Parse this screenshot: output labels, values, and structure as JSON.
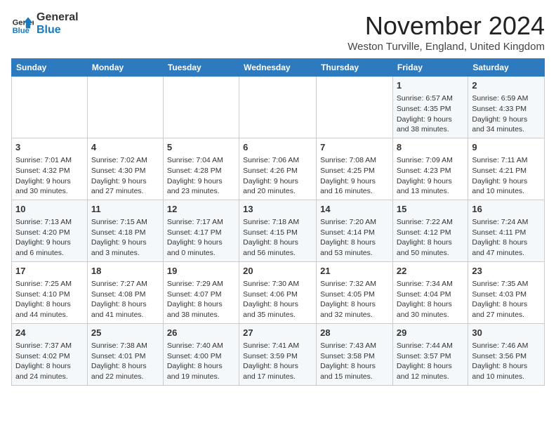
{
  "logo": {
    "line1": "General",
    "line2": "Blue"
  },
  "title": "November 2024",
  "location": "Weston Turville, England, United Kingdom",
  "days_of_week": [
    "Sunday",
    "Monday",
    "Tuesday",
    "Wednesday",
    "Thursday",
    "Friday",
    "Saturday"
  ],
  "weeks": [
    [
      {
        "day": "",
        "info": ""
      },
      {
        "day": "",
        "info": ""
      },
      {
        "day": "",
        "info": ""
      },
      {
        "day": "",
        "info": ""
      },
      {
        "day": "",
        "info": ""
      },
      {
        "day": "1",
        "info": "Sunrise: 6:57 AM\nSunset: 4:35 PM\nDaylight: 9 hours and 38 minutes."
      },
      {
        "day": "2",
        "info": "Sunrise: 6:59 AM\nSunset: 4:33 PM\nDaylight: 9 hours and 34 minutes."
      }
    ],
    [
      {
        "day": "3",
        "info": "Sunrise: 7:01 AM\nSunset: 4:32 PM\nDaylight: 9 hours and 30 minutes."
      },
      {
        "day": "4",
        "info": "Sunrise: 7:02 AM\nSunset: 4:30 PM\nDaylight: 9 hours and 27 minutes."
      },
      {
        "day": "5",
        "info": "Sunrise: 7:04 AM\nSunset: 4:28 PM\nDaylight: 9 hours and 23 minutes."
      },
      {
        "day": "6",
        "info": "Sunrise: 7:06 AM\nSunset: 4:26 PM\nDaylight: 9 hours and 20 minutes."
      },
      {
        "day": "7",
        "info": "Sunrise: 7:08 AM\nSunset: 4:25 PM\nDaylight: 9 hours and 16 minutes."
      },
      {
        "day": "8",
        "info": "Sunrise: 7:09 AM\nSunset: 4:23 PM\nDaylight: 9 hours and 13 minutes."
      },
      {
        "day": "9",
        "info": "Sunrise: 7:11 AM\nSunset: 4:21 PM\nDaylight: 9 hours and 10 minutes."
      }
    ],
    [
      {
        "day": "10",
        "info": "Sunrise: 7:13 AM\nSunset: 4:20 PM\nDaylight: 9 hours and 6 minutes."
      },
      {
        "day": "11",
        "info": "Sunrise: 7:15 AM\nSunset: 4:18 PM\nDaylight: 9 hours and 3 minutes."
      },
      {
        "day": "12",
        "info": "Sunrise: 7:17 AM\nSunset: 4:17 PM\nDaylight: 9 hours and 0 minutes."
      },
      {
        "day": "13",
        "info": "Sunrise: 7:18 AM\nSunset: 4:15 PM\nDaylight: 8 hours and 56 minutes."
      },
      {
        "day": "14",
        "info": "Sunrise: 7:20 AM\nSunset: 4:14 PM\nDaylight: 8 hours and 53 minutes."
      },
      {
        "day": "15",
        "info": "Sunrise: 7:22 AM\nSunset: 4:12 PM\nDaylight: 8 hours and 50 minutes."
      },
      {
        "day": "16",
        "info": "Sunrise: 7:24 AM\nSunset: 4:11 PM\nDaylight: 8 hours and 47 minutes."
      }
    ],
    [
      {
        "day": "17",
        "info": "Sunrise: 7:25 AM\nSunset: 4:10 PM\nDaylight: 8 hours and 44 minutes."
      },
      {
        "day": "18",
        "info": "Sunrise: 7:27 AM\nSunset: 4:08 PM\nDaylight: 8 hours and 41 minutes."
      },
      {
        "day": "19",
        "info": "Sunrise: 7:29 AM\nSunset: 4:07 PM\nDaylight: 8 hours and 38 minutes."
      },
      {
        "day": "20",
        "info": "Sunrise: 7:30 AM\nSunset: 4:06 PM\nDaylight: 8 hours and 35 minutes."
      },
      {
        "day": "21",
        "info": "Sunrise: 7:32 AM\nSunset: 4:05 PM\nDaylight: 8 hours and 32 minutes."
      },
      {
        "day": "22",
        "info": "Sunrise: 7:34 AM\nSunset: 4:04 PM\nDaylight: 8 hours and 30 minutes."
      },
      {
        "day": "23",
        "info": "Sunrise: 7:35 AM\nSunset: 4:03 PM\nDaylight: 8 hours and 27 minutes."
      }
    ],
    [
      {
        "day": "24",
        "info": "Sunrise: 7:37 AM\nSunset: 4:02 PM\nDaylight: 8 hours and 24 minutes."
      },
      {
        "day": "25",
        "info": "Sunrise: 7:38 AM\nSunset: 4:01 PM\nDaylight: 8 hours and 22 minutes."
      },
      {
        "day": "26",
        "info": "Sunrise: 7:40 AM\nSunset: 4:00 PM\nDaylight: 8 hours and 19 minutes."
      },
      {
        "day": "27",
        "info": "Sunrise: 7:41 AM\nSunset: 3:59 PM\nDaylight: 8 hours and 17 minutes."
      },
      {
        "day": "28",
        "info": "Sunrise: 7:43 AM\nSunset: 3:58 PM\nDaylight: 8 hours and 15 minutes."
      },
      {
        "day": "29",
        "info": "Sunrise: 7:44 AM\nSunset: 3:57 PM\nDaylight: 8 hours and 12 minutes."
      },
      {
        "day": "30",
        "info": "Sunrise: 7:46 AM\nSunset: 3:56 PM\nDaylight: 8 hours and 10 minutes."
      }
    ]
  ]
}
